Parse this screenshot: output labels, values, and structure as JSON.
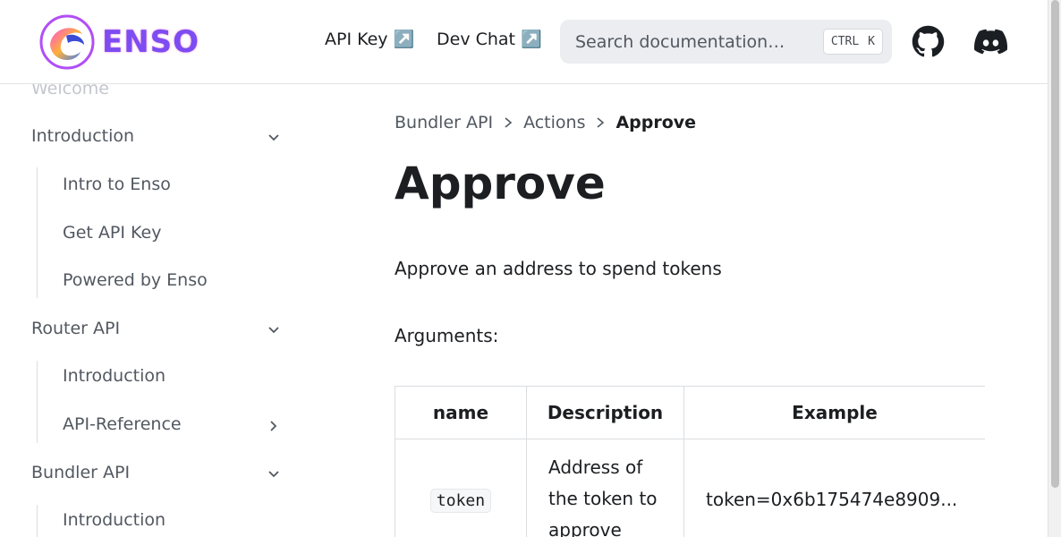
{
  "navbar": {
    "logo_text": "ENSO",
    "links": [
      {
        "label": "API Key ↗️"
      },
      {
        "label": "Dev Chat ↗️"
      }
    ],
    "search": {
      "placeholder": "Search documentation…",
      "shortcut_ctrl": "CTRL",
      "shortcut_key": "K"
    },
    "icons": [
      "github-icon",
      "discord-icon"
    ]
  },
  "sidebar": {
    "welcome": "Welcome",
    "sections": [
      {
        "label": "Introduction",
        "expanded": true,
        "items": [
          "Intro to Enso",
          "Get API Key",
          "Powered by Enso"
        ]
      },
      {
        "label": "Router API",
        "expanded": true,
        "items": [
          "Introduction",
          "API-Reference"
        ]
      },
      {
        "label": "Bundler API",
        "expanded": true,
        "items": [
          "Introduction"
        ]
      }
    ]
  },
  "main": {
    "breadcrumb": [
      "Bundler API",
      "Actions",
      "Approve"
    ],
    "title": "Approve",
    "description": "Approve an address to spend tokens",
    "arguments_label": "Arguments:",
    "table": {
      "headers": [
        "name",
        "Description",
        "Example"
      ],
      "rows": [
        {
          "name": "token",
          "description": "Address of the token to approve",
          "example": "token=0x6b175474e8909..."
        }
      ]
    }
  },
  "colors": {
    "accent": "#7b4df2",
    "text": "#1c1e21",
    "muted": "#525860",
    "border": "#dadde1"
  }
}
